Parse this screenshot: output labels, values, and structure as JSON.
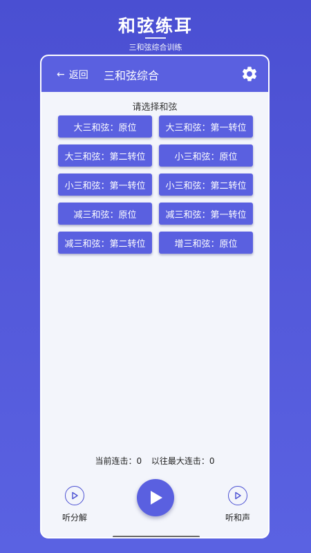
{
  "promo": {
    "title": "和弦练耳",
    "subtitle": "三和弦综合训练"
  },
  "appbar": {
    "back_label": "返回",
    "back_icon": "arrow-left-icon",
    "title": "三和弦综合",
    "settings_icon": "gear-icon"
  },
  "section_title": "请选择和弦",
  "chords": [
    "大三和弦：原位",
    "大三和弦：第一转位",
    "大三和弦：第二转位",
    "小三和弦：原位",
    "小三和弦：第一转位",
    "小三和弦：第二转位",
    "减三和弦：原位",
    "减三和弦：第一转位",
    "减三和弦：第二转位",
    "增三和弦：原位"
  ],
  "stats": {
    "current_streak": "当前连击：0",
    "best_streak": "以往最大连击：0"
  },
  "controls": {
    "listen_split": "听分解",
    "listen_harmony": "听和声",
    "play_icon": "play-icon"
  },
  "colors": {
    "accent": "#5a60e0",
    "background": "#4a4fd2",
    "panel": "#f3f5fb"
  }
}
